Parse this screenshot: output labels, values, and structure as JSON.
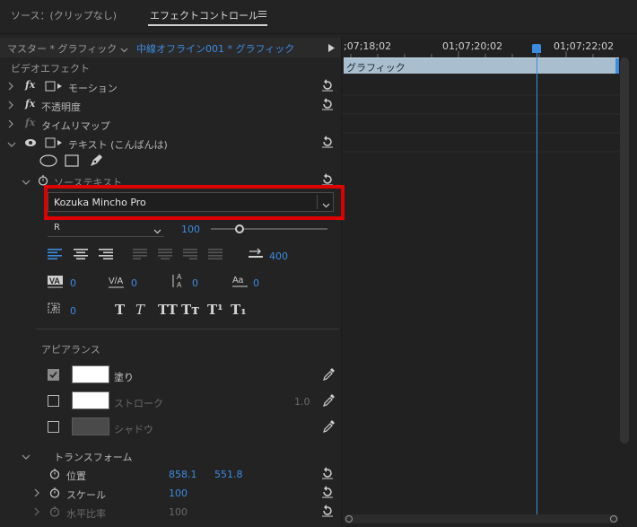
{
  "tabs": {
    "source": "ソース：(クリップなし)",
    "effect_controls": "エフェクトコントロール",
    "menu_icon": "hamburger-icon"
  },
  "header": {
    "master": "マスター * グラフィック",
    "sequence": "中線オフライン001 * グラフィック"
  },
  "timeline": {
    "ruler": [
      ";07;18;02",
      "01;07;20;02",
      "01;07;22;02"
    ],
    "clip": "グラフィック",
    "playhead_color": "#3d8be0",
    "clip_color": "#a9bfd0"
  },
  "section": "ビデオエフェクト",
  "effects": [
    {
      "fx": "fx",
      "label": "モーション"
    },
    {
      "fx": "fx",
      "label": "不透明度"
    },
    {
      "fx": "fx",
      "label": "タイムリマップ"
    },
    {
      "label": "テキスト (こんばんは)"
    }
  ],
  "source_text": {
    "label": "ソーステキスト",
    "font": "Kozuka Mincho Pro",
    "style": "R",
    "size": "100",
    "tracking_value": "400",
    "kerning": "0",
    "tracking": "0",
    "leading": "0",
    "baseline": "0",
    "tsume": "0",
    "char_buttons": [
      "T",
      "T",
      "TT",
      "Tт",
      "T¹",
      "T₁"
    ]
  },
  "appearance": {
    "title": "アピアランス",
    "fill": "塗り",
    "stroke": "ストローク",
    "stroke_width": "1.0",
    "shadow": "シャドウ"
  },
  "transform": {
    "title": "トランスフォーム",
    "position": "位置",
    "pos_x": "858.1",
    "pos_y": "551.8",
    "scale": "スケール",
    "scale_value": "100",
    "hscale": "水平比率",
    "hscale_value": "100"
  }
}
